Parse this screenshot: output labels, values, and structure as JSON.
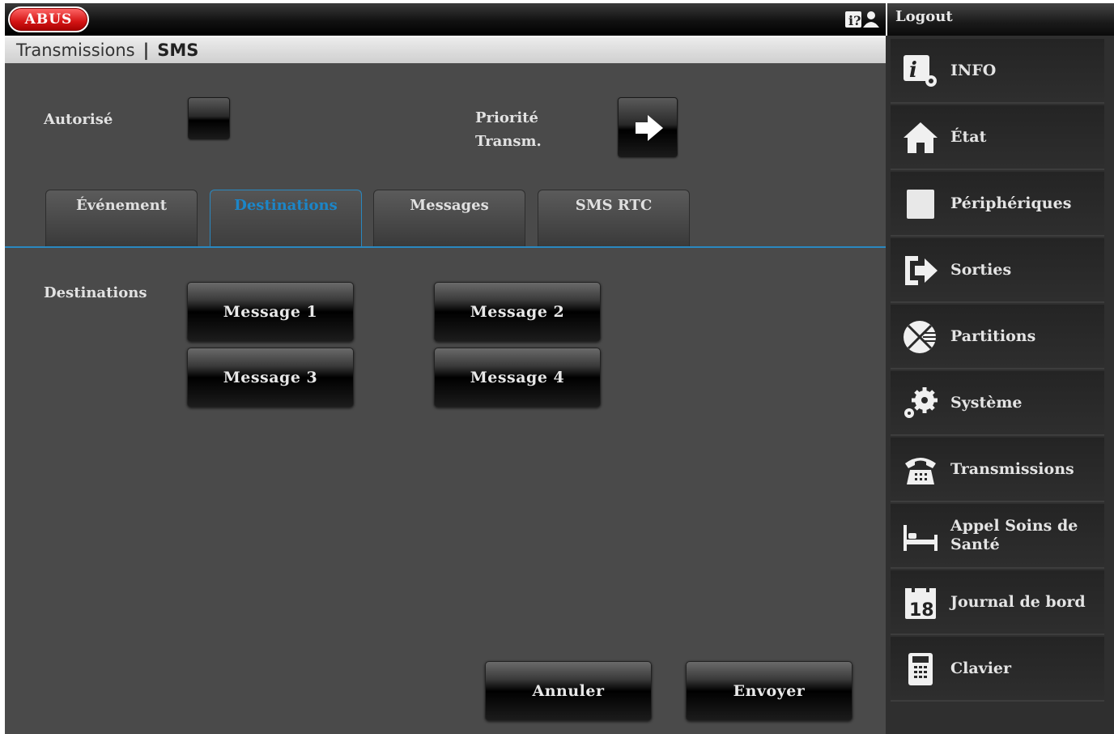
{
  "header": {
    "logo_text": "ABUS",
    "logout_label": "Logout"
  },
  "breadcrumb": {
    "section": "Transmissions",
    "separator": "|",
    "current": "SMS"
  },
  "form": {
    "authorized_label": "Autorisé",
    "priority_label_line1": "Priorité",
    "priority_label_line2": "Transm.",
    "priority_icon": "arrow-right-icon"
  },
  "tabs": [
    {
      "label": "Événement",
      "active": false
    },
    {
      "label": "Destinations",
      "active": true
    },
    {
      "label": "Messages",
      "active": false
    },
    {
      "label": "SMS RTC",
      "active": false
    }
  ],
  "destinations": {
    "label": "Destinations",
    "buttons": [
      "Message 1",
      "Message 2",
      "Message 3",
      "Message 4"
    ]
  },
  "actions": {
    "cancel_label": "Annuler",
    "send_label": "Envoyer"
  },
  "sidebar": {
    "items": [
      {
        "label": "INFO",
        "icon": "info-gear-icon"
      },
      {
        "label": "État",
        "icon": "home-icon"
      },
      {
        "label": "Périphériques",
        "icon": "device-square-icon"
      },
      {
        "label": "Sorties",
        "icon": "exit-arrow-icon"
      },
      {
        "label": "Partitions",
        "icon": "partitions-pie-icon"
      },
      {
        "label": "Système",
        "icon": "gears-icon"
      },
      {
        "label": "Transmissions",
        "icon": "telephone-icon"
      },
      {
        "label": "Appel Soins de Santé",
        "icon": "bed-icon"
      },
      {
        "label": "Journal de bord",
        "icon": "calendar-icon"
      },
      {
        "label": "Clavier",
        "icon": "keypad-icon"
      }
    ],
    "calendar_day": "18"
  }
}
